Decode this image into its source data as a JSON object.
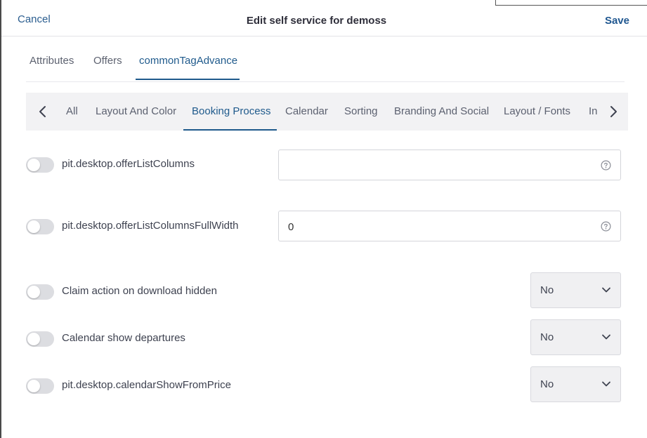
{
  "header": {
    "cancel_label": "Cancel",
    "title": "Edit self service for demoss",
    "save_label": "Save"
  },
  "top_tabs": [
    {
      "label": "Attributes",
      "active": false
    },
    {
      "label": "Offers",
      "active": false
    },
    {
      "label": "commonTagAdvance",
      "active": true
    }
  ],
  "sub_tabs": [
    {
      "label": "All",
      "active": false
    },
    {
      "label": "Layout And Color",
      "active": false
    },
    {
      "label": "Booking Process",
      "active": true
    },
    {
      "label": "Calendar",
      "active": false
    },
    {
      "label": "Sorting",
      "active": false
    },
    {
      "label": "Branding And Social",
      "active": false
    },
    {
      "label": "Layout / Fonts",
      "active": false
    },
    {
      "label": "In",
      "active": false
    }
  ],
  "settings": [
    {
      "label": "pit.desktop.offerListColumns",
      "enabled": false,
      "control": "text",
      "value": ""
    },
    {
      "label": "pit.desktop.offerListColumnsFullWidth",
      "enabled": false,
      "control": "text",
      "value": "0"
    },
    {
      "label": "Claim action on download hidden",
      "enabled": false,
      "control": "select",
      "value": "No"
    },
    {
      "label": "Calendar show departures",
      "enabled": false,
      "control": "select",
      "value": "No"
    },
    {
      "label": "pit.desktop.calendarShowFromPrice",
      "enabled": false,
      "control": "select",
      "value": "No"
    }
  ],
  "colors": {
    "accent": "#1f5a8c",
    "tab_bar_bg": "#f2f2f4",
    "toggle_off": "#dcdde1"
  },
  "icons": {
    "prev": "chevron-left-icon",
    "next": "chevron-right-icon",
    "help": "question-circle-icon",
    "dropdown": "chevron-down-icon"
  }
}
